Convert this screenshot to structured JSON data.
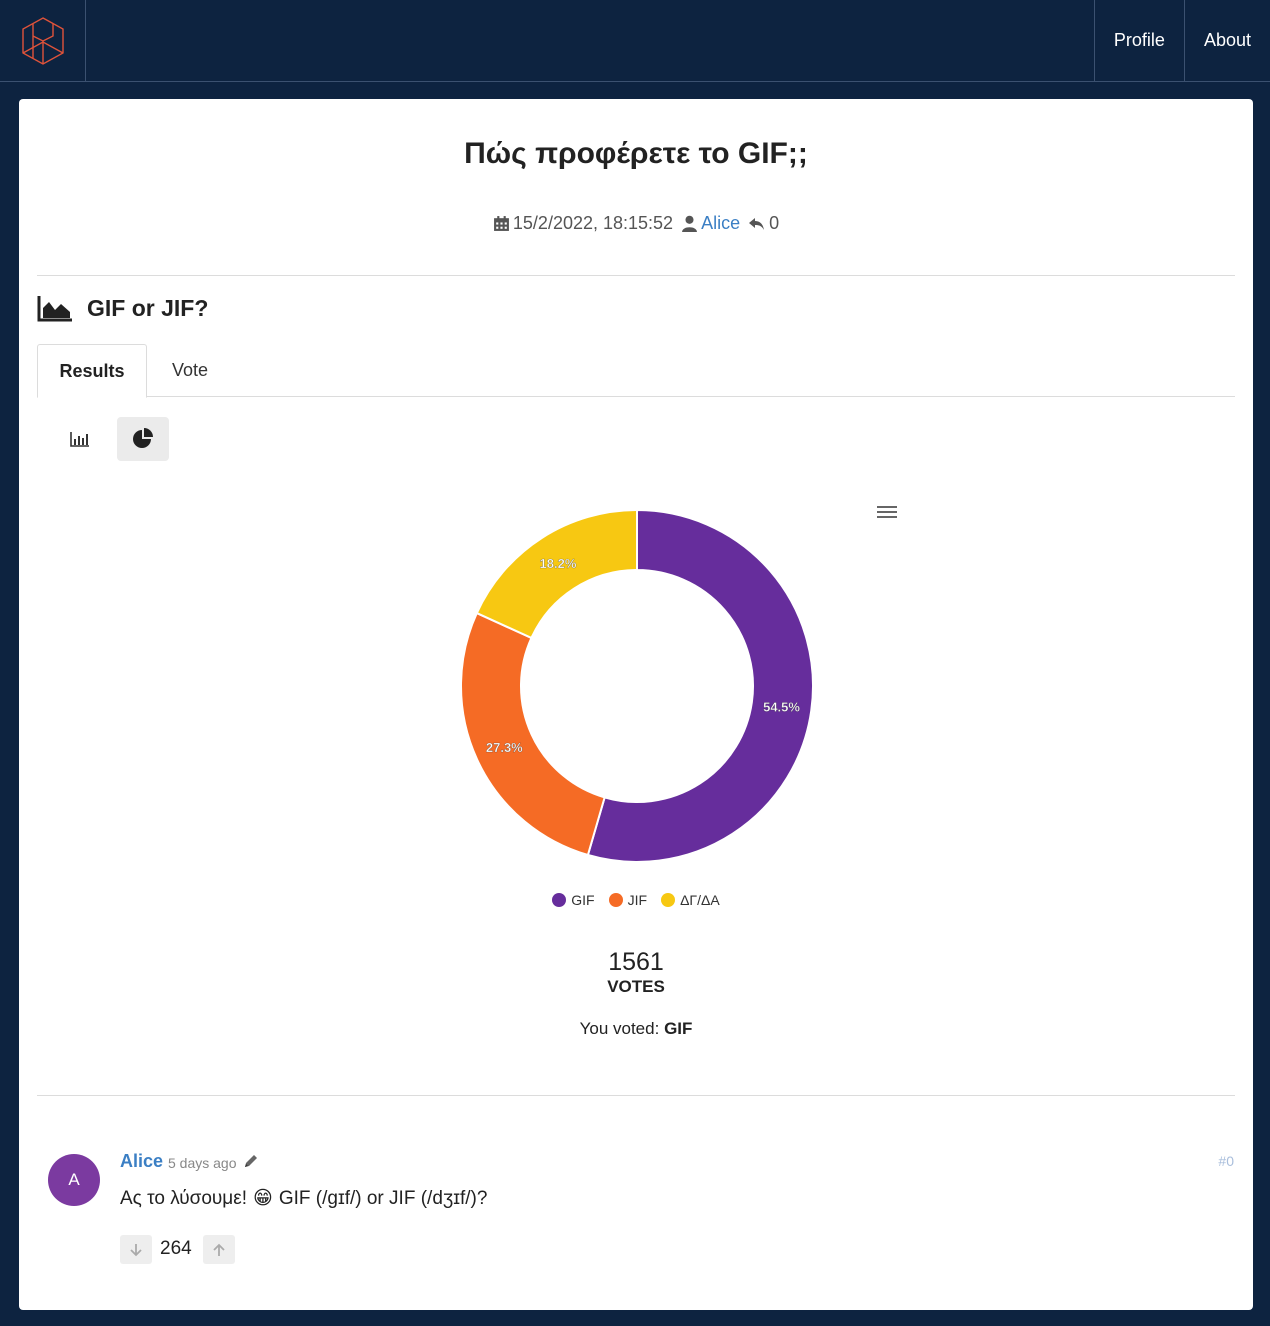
{
  "nav": {
    "logo": "site-logo",
    "links": [
      "Profile",
      "About"
    ]
  },
  "post": {
    "title": "Πώς προφέρετε το GIF;;",
    "date": "15/2/2022, 18:15:52",
    "author": "Alice",
    "replies": "0"
  },
  "poll": {
    "title": "GIF or JIF?",
    "tabs": [
      "Results",
      "Vote"
    ],
    "active_tab": "Results",
    "votes_total": "1561",
    "votes_label": "VOTES",
    "you_voted_prefix": "You voted:",
    "you_voted_value": "GIF"
  },
  "chart_data": {
    "type": "pie",
    "categories": [
      "GIF",
      "JIF",
      "ΔΓ/ΔΑ"
    ],
    "values": [
      54.5,
      27.3,
      18.2
    ],
    "labels": [
      "54.5%",
      "27.3%",
      "18.2%"
    ],
    "colors": [
      "#662d9c",
      "#f56b25",
      "#f7c812"
    ],
    "legend": "bottom",
    "donut": true
  },
  "comment": {
    "avatar_letter": "A",
    "author": "Alice",
    "time": "5 days ago",
    "permalink": "#0",
    "text_before": "Ας το λύσουμε!",
    "emoji": "😁",
    "text_after": "GIF (/ɡɪf/) or JIF (/dʒɪf/)?",
    "score": "264"
  }
}
